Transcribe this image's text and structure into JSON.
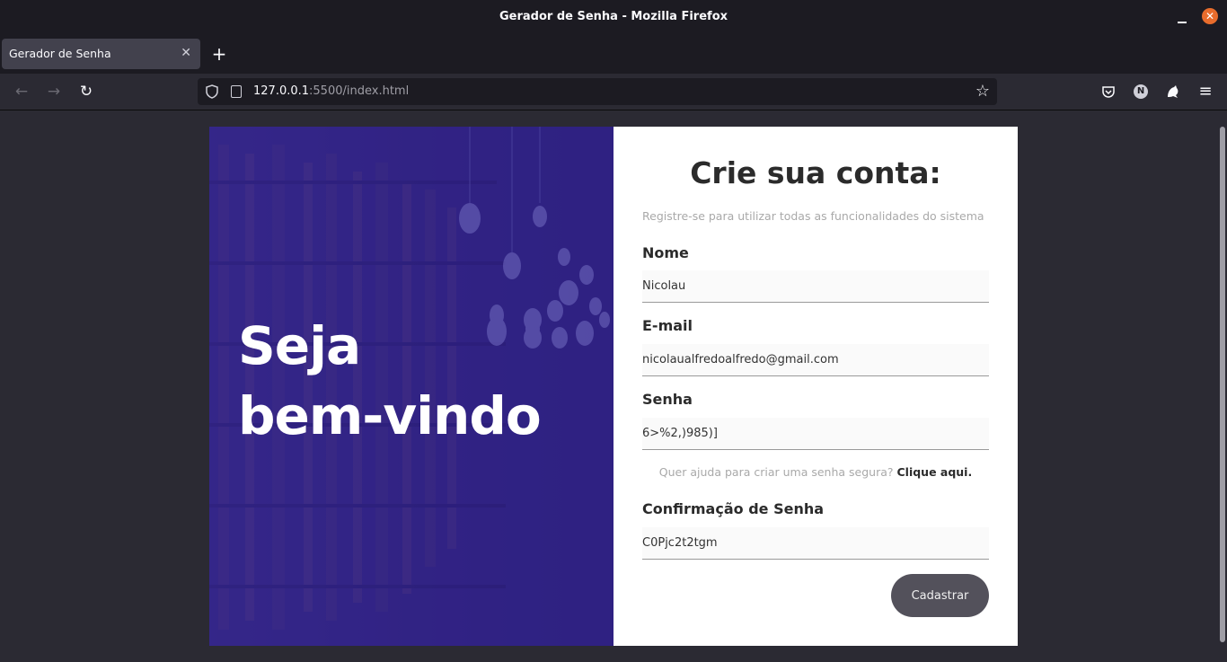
{
  "window": {
    "title": "Gerador de Senha - Mozilla Firefox",
    "close_glyph": "✕"
  },
  "tabs": [
    {
      "label": "Gerador de Senha",
      "close_glyph": "✕"
    }
  ],
  "newtab_glyph": "+",
  "navbar": {
    "url_host": "127.0.0.1",
    "url_rest": ":5500/index.html",
    "back_glyph": "←",
    "forward_glyph": "→",
    "reload_glyph": "↻",
    "star_glyph": "☆",
    "avatar_letter": "N",
    "menu_glyph": "≡"
  },
  "hero": {
    "line1": "Seja",
    "line2": "bem-vindo"
  },
  "form": {
    "title": "Crie sua conta:",
    "subtitle": "Registre-se para utilizar todas as funcionalidades do sistema",
    "fields": [
      {
        "label": "Nome",
        "value": "Nicolau"
      },
      {
        "label": "E-mail",
        "value": "nicolaualfredoalfredo@gmail.com"
      },
      {
        "label": "Senha",
        "value": "6>%2,)985)]"
      },
      {
        "label": "Confirmação de Senha",
        "value": "C0Pjc2t2tgm"
      }
    ],
    "help_text": "Quer ajuda para criar uma senha segura?",
    "help_link": "Clique aqui.",
    "submit_label": "Cadastrar"
  },
  "colors": {
    "hero_overlay": "#2f2180",
    "button": "#53515b",
    "browser_bg": "#2b2a33"
  }
}
